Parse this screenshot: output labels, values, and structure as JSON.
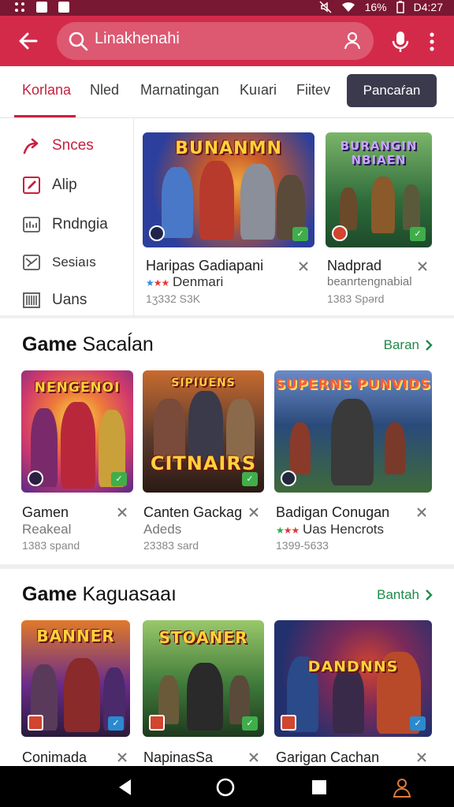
{
  "status_bar": {
    "battery": "16%",
    "time": "D4:27"
  },
  "app_bar": {
    "search_text": "Linakhenahi"
  },
  "tabs": [
    {
      "label": "Korlana",
      "active": true
    },
    {
      "label": "Nled",
      "active": false
    },
    {
      "label": "Marnatingan",
      "active": false
    },
    {
      "label": "Kuıari",
      "active": false
    },
    {
      "label": "Fiitev",
      "active": false
    }
  ],
  "tab_button": "Pancaŕan",
  "sidebar": {
    "items": [
      {
        "label": "Snces",
        "icon": "trending-arrow-icon",
        "active": true
      },
      {
        "label": "Alip",
        "icon": "edit-square-icon",
        "active": false
      },
      {
        "label": "Rndngia",
        "icon": "chart-box-icon",
        "active": false
      },
      {
        "label": "Sesiaıs",
        "icon": "mail-box-icon",
        "active": false
      },
      {
        "label": "Uans",
        "icon": "barcode-list-icon",
        "active": false
      }
    ]
  },
  "featured": [
    {
      "art_title": "BUNANMN",
      "title": "Haripas Gadiapani",
      "subtitle": "Denmari",
      "meta": "1ʒ332 S3K",
      "colors": [
        "#2c3f9c",
        "#f0a02a"
      ]
    },
    {
      "art_title": "BURANGIN NBIAEN",
      "title": "Nadprad",
      "subtitle": "beanrtengnabial",
      "meta": "1383 Spərd",
      "colors": [
        "#2e6b3a",
        "#7bb56a"
      ]
    }
  ],
  "section1": {
    "title_bold": "Game",
    "title_rest": "Sacaĺan",
    "more": "Baran",
    "cards": [
      {
        "art_title": "NENGENOI",
        "title": "Gamen",
        "subtitle": "Reakeal",
        "meta": "1383 spand",
        "colors": [
          "#d23a6b",
          "#f5c84a"
        ]
      },
      {
        "art_title": "CITNAIRS",
        "title": "Canten Gackag",
        "subtitle": "Adeds",
        "meta": "23383 sard",
        "colors": [
          "#5b3a2c",
          "#c76b2f"
        ]
      },
      {
        "art_title": "SUPERNS PUNVIDS",
        "title": "Badigan Conugan",
        "subtitle": "Uas Hencrots",
        "meta": "1399-5633",
        "colors": [
          "#2a4a7a",
          "#6fae6a"
        ]
      }
    ]
  },
  "section2": {
    "title_bold": "Game",
    "title_rest": "Kaguasaaı",
    "more": "Bantah",
    "cards": [
      {
        "art_title": "BANNER",
        "title": "Conimada",
        "colors": [
          "#6a2c8a",
          "#e07a2a"
        ]
      },
      {
        "art_title": "STOANER",
        "title": "NapinasSa",
        "colors": [
          "#3f7a3a",
          "#d9b43a"
        ]
      },
      {
        "art_title": "DANDNNS",
        "title": "Garigan Cachan",
        "colors": [
          "#23306e",
          "#d2452e"
        ]
      }
    ]
  }
}
